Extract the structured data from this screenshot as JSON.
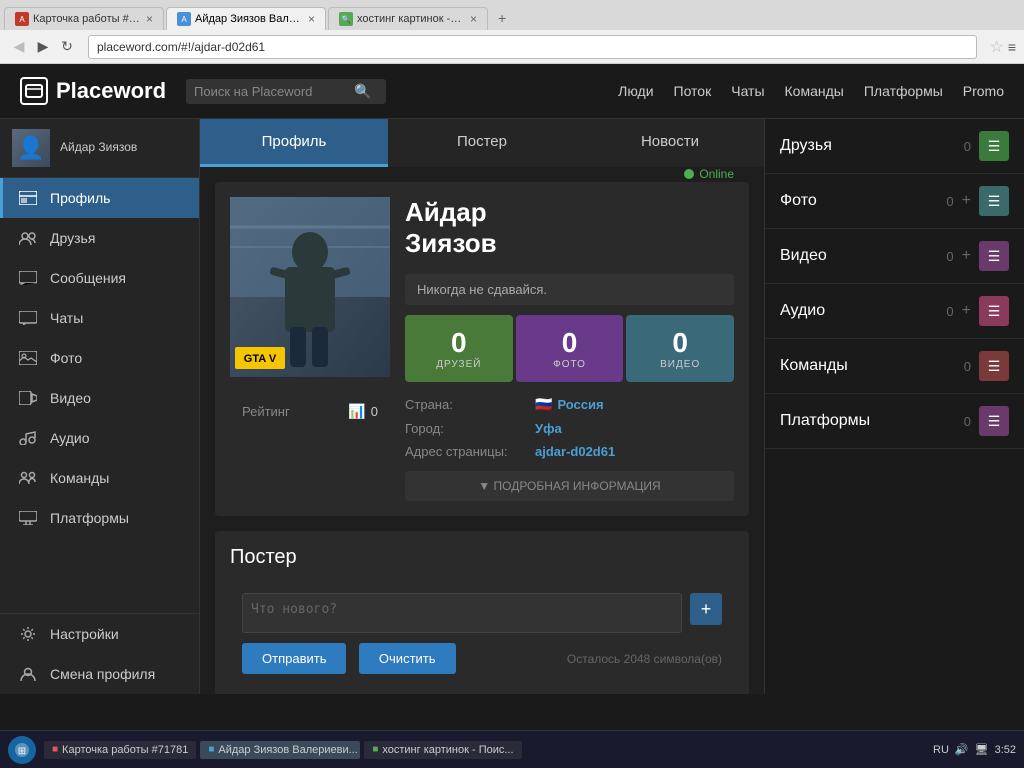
{
  "browser": {
    "tabs": [
      {
        "id": "tab1",
        "title": "Карточка работы #71781",
        "icon": "red",
        "active": false
      },
      {
        "id": "tab2",
        "title": "Айдар Зиязов Валериеви...",
        "icon": "blue",
        "active": true
      },
      {
        "id": "tab3",
        "title": "хостинг картинок - Поис...",
        "icon": "green",
        "active": false
      }
    ],
    "address": "placeword.com/#!/ajdar-d02d61",
    "star": "☆"
  },
  "topnav": {
    "logo": "Placeword",
    "search_placeholder": "Поиск на Placeword",
    "links": [
      "Люди",
      "Поток",
      "Чаты",
      "Команды",
      "Платформы",
      "Promo"
    ]
  },
  "sidebar": {
    "user_name": "Айдар\nЗиязов",
    "items": [
      {
        "id": "profile",
        "label": "Профиль",
        "active": true
      },
      {
        "id": "friends",
        "label": "Друзья",
        "active": false
      },
      {
        "id": "messages",
        "label": "Сообщения",
        "active": false
      },
      {
        "id": "chats",
        "label": "Чаты",
        "active": false
      },
      {
        "id": "photos",
        "label": "Фото",
        "active": false
      },
      {
        "id": "videos",
        "label": "Видео",
        "active": false
      },
      {
        "id": "audio",
        "label": "Аудио",
        "active": false
      },
      {
        "id": "teams",
        "label": "Команды",
        "active": false
      },
      {
        "id": "platforms",
        "label": "Платформы",
        "active": false
      },
      {
        "id": "settings",
        "label": "Настройки",
        "active": false
      },
      {
        "id": "switch",
        "label": "Смена профиля",
        "active": false
      }
    ]
  },
  "profile": {
    "tabs": [
      "Профиль",
      "Постер",
      "Новости"
    ],
    "active_tab": 0,
    "name": "Айдар\nЗиязов",
    "online_status": "Online",
    "motto": "Никогда не сдавайся.",
    "rating_label": "Рейтинг",
    "rating_value": "0",
    "stats": [
      {
        "label": "ДРУЗЕЙ",
        "value": "0",
        "color": "green"
      },
      {
        "label": "ФОТО",
        "value": "0",
        "color": "purple"
      },
      {
        "label": "ВИДЕО",
        "value": "0",
        "color": "teal"
      }
    ],
    "details": [
      {
        "label": "Страна:",
        "value": "Россия",
        "flag": "🇷🇺"
      },
      {
        "label": "Город:",
        "value": "Уфа"
      },
      {
        "label": "Адрес страницы:",
        "value": "ajdar-d02d61"
      }
    ],
    "show_more": "▼  ПОДРОБНАЯ ИНФОРМАЦИЯ"
  },
  "poster": {
    "title": "Постер",
    "placeholder": "Что нового?",
    "submit_label": "Отправить",
    "clear_label": "Очистить",
    "chars_left": "Осталось 2048 символа(ов)"
  },
  "right_sidebar": {
    "widgets": [
      {
        "id": "friends",
        "label": "Друзья",
        "count": "0",
        "color": "green",
        "show_add": false
      },
      {
        "id": "photos",
        "label": "Фото",
        "count": "0",
        "color": "teal",
        "show_add": true
      },
      {
        "id": "videos",
        "label": "Видео",
        "count": "0",
        "color": "purple",
        "show_add": true
      },
      {
        "id": "audio",
        "label": "Аудио",
        "count": "0",
        "color": "pink",
        "show_add": true
      },
      {
        "id": "teams",
        "label": "Команды",
        "count": "0",
        "color": "red",
        "show_add": false
      },
      {
        "id": "platforms",
        "label": "Платформы",
        "count": "0",
        "color": "purple",
        "show_add": false
      }
    ]
  },
  "taskbar": {
    "items": [
      {
        "label": "Карточка работы #71781",
        "active": false
      },
      {
        "label": "Айдар Зиязов Валериеви...",
        "active": true
      },
      {
        "label": "хостинг картинок - Поис...",
        "active": false
      }
    ],
    "tray": {
      "lang": "RU",
      "time": "3:52"
    }
  }
}
